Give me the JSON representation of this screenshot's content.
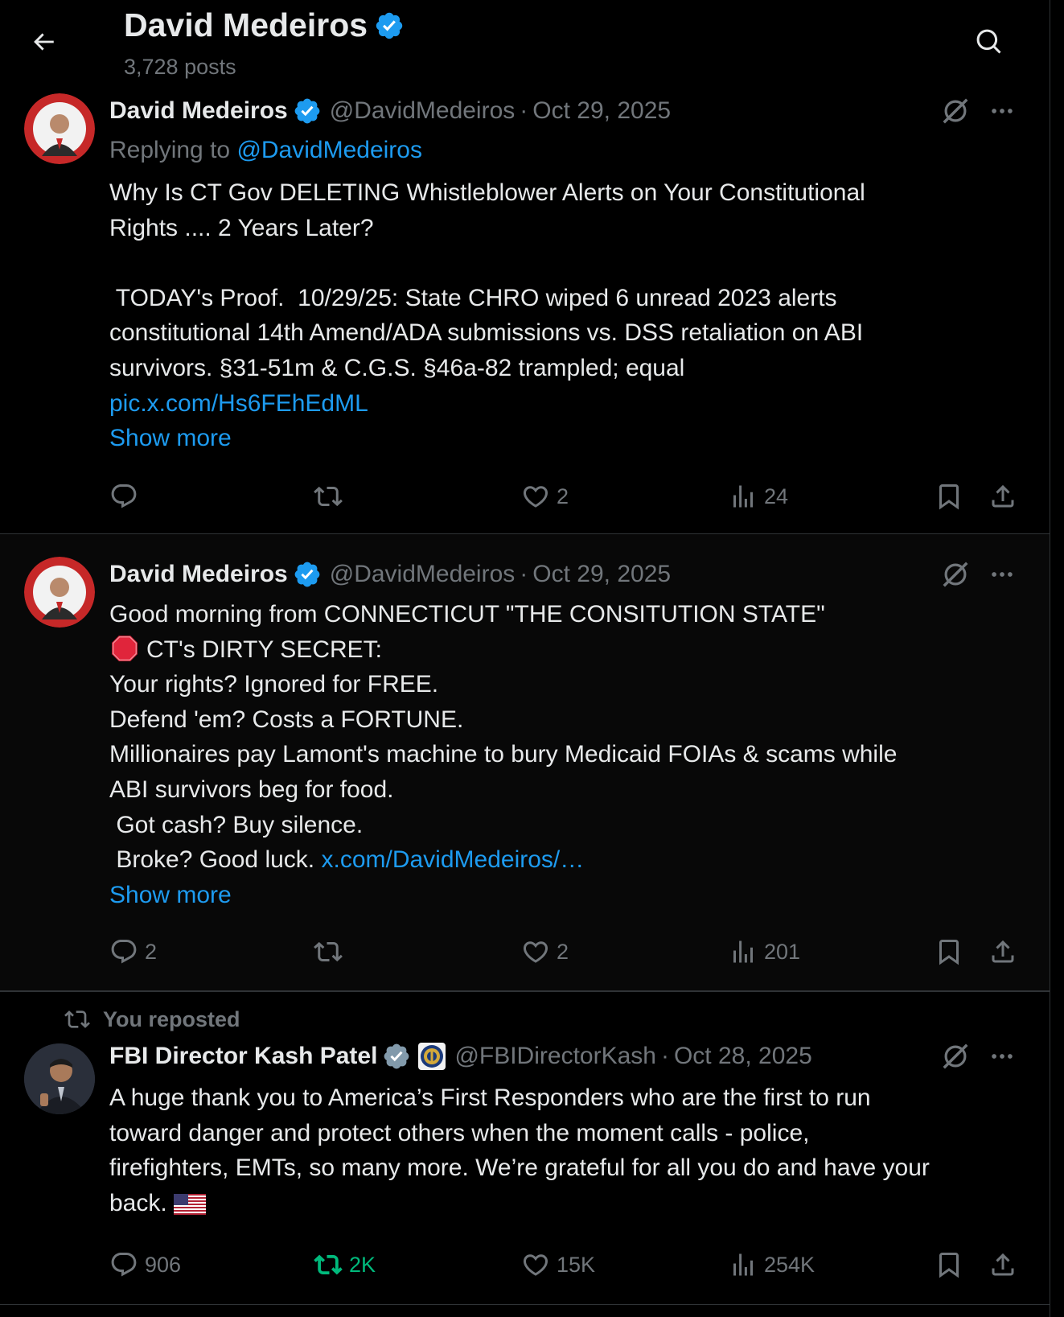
{
  "header": {
    "title": "David Medeiros",
    "post_count": "3,728 posts"
  },
  "tweets": [
    {
      "author": "David Medeiros",
      "handle": "@DavidMedeiros",
      "separator": "·",
      "date": "Oct 29, 2025",
      "reply_prefix": "Replying to",
      "reply_handle": "@DavidMedeiros",
      "text_lines": [
        "Why Is CT Gov DELETING Whistleblower Alerts on Your Constitutional",
        "Rights .... 2 Years Later?",
        "",
        " TODAY's Proof.  10/29/25: State CHRO wiped 6 unread 2023 alerts",
        "constitutional 14th Amend/ADA submissions vs. DSS retaliation on ABI",
        "survivors. §31-51m & C.G.S. §46a-82 trampled; equal"
      ],
      "link": "pic.x.com/Hs6FEhEdML",
      "show_more": "Show more",
      "stats": {
        "replies": "",
        "reposts": "",
        "likes": "2",
        "views": "24"
      }
    },
    {
      "author": "David Medeiros",
      "handle": "@DavidMedeiros",
      "separator": "·",
      "date": "Oct 29, 2025",
      "text_lines": [
        "Good morning from CONNECTICUT \"THE CONSITUTION STATE\"",
        "CT's DIRTY SECRET:",
        "Your rights? Ignored for FREE.",
        "Defend 'em? Costs a FORTUNE.",
        "Millionaires pay Lamont's machine to bury Medicaid FOIAs & scams while",
        "ABI survivors beg for food.",
        " Got cash? Buy silence.",
        " Broke? Good luck."
      ],
      "link": "x.com/DavidMedeiros/…",
      "show_more": "Show more",
      "stats": {
        "replies": "2",
        "reposts": "",
        "likes": "2",
        "views": "201"
      }
    },
    {
      "repost_label": "You reposted",
      "author": "FBI Director Kash Patel",
      "handle": "@FBIDirectorKash",
      "separator": "·",
      "date": "Oct 28, 2025",
      "text_lines": [
        "A huge thank you to America’s First Responders who are the first to run",
        "toward danger and protect others when the moment calls - police,",
        "firefighters, EMTs, so many more. We’re grateful for all you do and have your",
        "back."
      ],
      "stats": {
        "replies": "906",
        "reposts": "2K",
        "likes": "15K",
        "views": "254K"
      }
    }
  ],
  "colors": {
    "background": "#000000",
    "text": "#e7e9ea",
    "muted": "#71767b",
    "link": "#1d9bf0",
    "repost_active": "#00ba7c",
    "divider": "#2f3336",
    "verified": "#1d9bf0"
  },
  "icons": [
    "back-arrow-icon",
    "search-icon",
    "verified-badge-icon",
    "grok-icon",
    "more-icon",
    "reply-icon",
    "repost-icon",
    "like-icon",
    "views-icon",
    "bookmark-icon",
    "share-icon",
    "stop-sign-icon",
    "us-flag-icon",
    "fbi-seal-icon"
  ]
}
